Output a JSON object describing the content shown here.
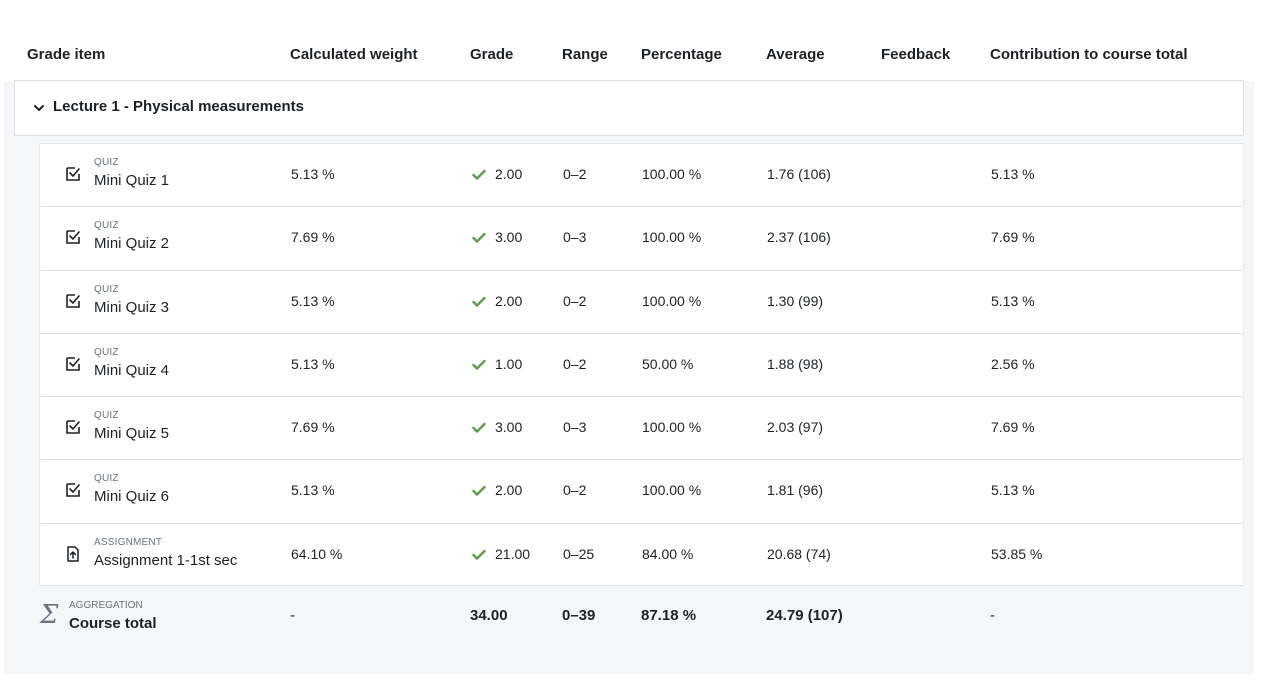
{
  "columns": {
    "grade_item": "Grade item",
    "calculated_weight": "Calculated weight",
    "grade": "Grade",
    "range": "Range",
    "percentage": "Percentage",
    "average": "Average",
    "feedback": "Feedback",
    "contribution": "Contribution to course total"
  },
  "category": {
    "label": "Lecture 1 - Physical measurements",
    "icon": "chevron-down-icon"
  },
  "items": [
    {
      "type": "QUIZ",
      "name": "Mini Quiz 1",
      "icon": "quiz-icon",
      "weight": "5.13 %",
      "grade": "2.00",
      "range": "0–2",
      "percentage": "100.00 %",
      "average": "1.76 (106)",
      "feedback": "",
      "contribution": "5.13 %"
    },
    {
      "type": "QUIZ",
      "name": "Mini Quiz 2",
      "icon": "quiz-icon",
      "weight": "7.69 %",
      "grade": "3.00",
      "range": "0–3",
      "percentage": "100.00 %",
      "average": "2.37 (106)",
      "feedback": "",
      "contribution": "7.69 %"
    },
    {
      "type": "QUIZ",
      "name": "Mini Quiz 3",
      "icon": "quiz-icon",
      "weight": "5.13 %",
      "grade": "2.00",
      "range": "0–2",
      "percentage": "100.00 %",
      "average": "1.30 (99)",
      "feedback": "",
      "contribution": "5.13 %"
    },
    {
      "type": "QUIZ",
      "name": "Mini Quiz 4",
      "icon": "quiz-icon",
      "weight": "5.13 %",
      "grade": "1.00",
      "range": "0–2",
      "percentage": "50.00 %",
      "average": "1.88 (98)",
      "feedback": "",
      "contribution": "2.56 %"
    },
    {
      "type": "QUIZ",
      "name": "Mini Quiz 5",
      "icon": "quiz-icon",
      "weight": "7.69 %",
      "grade": "3.00",
      "range": "0–3",
      "percentage": "100.00 %",
      "average": "2.03 (97)",
      "feedback": "",
      "contribution": "7.69 %"
    },
    {
      "type": "QUIZ",
      "name": "Mini Quiz 6",
      "icon": "quiz-icon",
      "weight": "5.13 %",
      "grade": "2.00",
      "range": "0–2",
      "percentage": "100.00 %",
      "average": "1.81 (96)",
      "feedback": "",
      "contribution": "5.13 %"
    },
    {
      "type": "ASSIGNMENT",
      "name": "Assignment 1-1st sec",
      "icon": "assignment-upload-icon",
      "weight": "64.10 %",
      "grade": "21.00",
      "range": "0–25",
      "percentage": "84.00 %",
      "average": "20.68 (74)",
      "feedback": "",
      "contribution": "53.85 %"
    }
  ],
  "total": {
    "type": "AGGREGATION",
    "name": "Course total",
    "icon": "sigma-icon",
    "symbol": "Σ",
    "weight": "-",
    "grade": "34.00",
    "range": "0–39",
    "percentage": "87.18 %",
    "average": "24.79 (107)",
    "contribution": "-"
  },
  "colors": {
    "check": "#5a9e4b",
    "panel_bg": "#f5f6f7",
    "border": "#dee2e6"
  }
}
